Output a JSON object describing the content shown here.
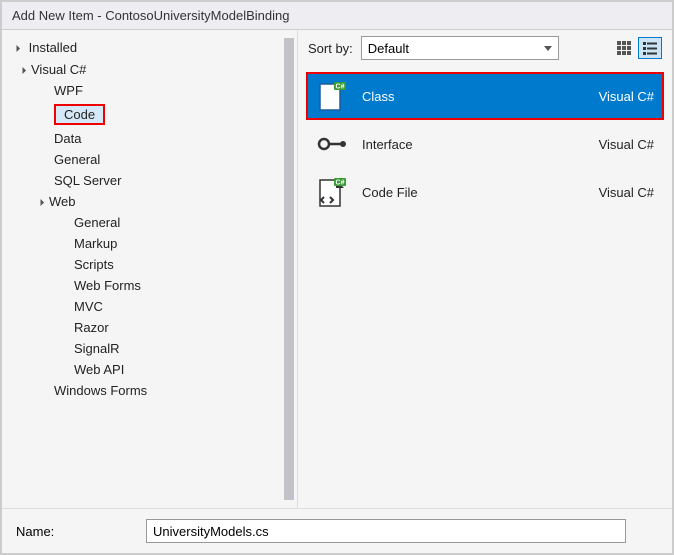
{
  "titlebar": "Add New Item - ContosoUniversityModelBinding",
  "sidebar": {
    "rootHeader": "Installed",
    "items": [
      "Visual C#",
      "WPF",
      "Code",
      "Data",
      "General",
      "SQL Server",
      "Web",
      "General",
      "Markup",
      "Scripts",
      "Web Forms",
      "MVC",
      "Razor",
      "SignalR",
      "Web API",
      "Windows Forms"
    ]
  },
  "toolbar": {
    "sortLabel": "Sort by:",
    "sortValue": "Default"
  },
  "templates": [
    {
      "name": "Class",
      "lang": "Visual C#",
      "selected": true
    },
    {
      "name": "Interface",
      "lang": "Visual C#",
      "selected": false
    },
    {
      "name": "Code File",
      "lang": "Visual C#",
      "selected": false
    }
  ],
  "nameRow": {
    "label": "Name:",
    "value": "UniversityModels.cs"
  }
}
